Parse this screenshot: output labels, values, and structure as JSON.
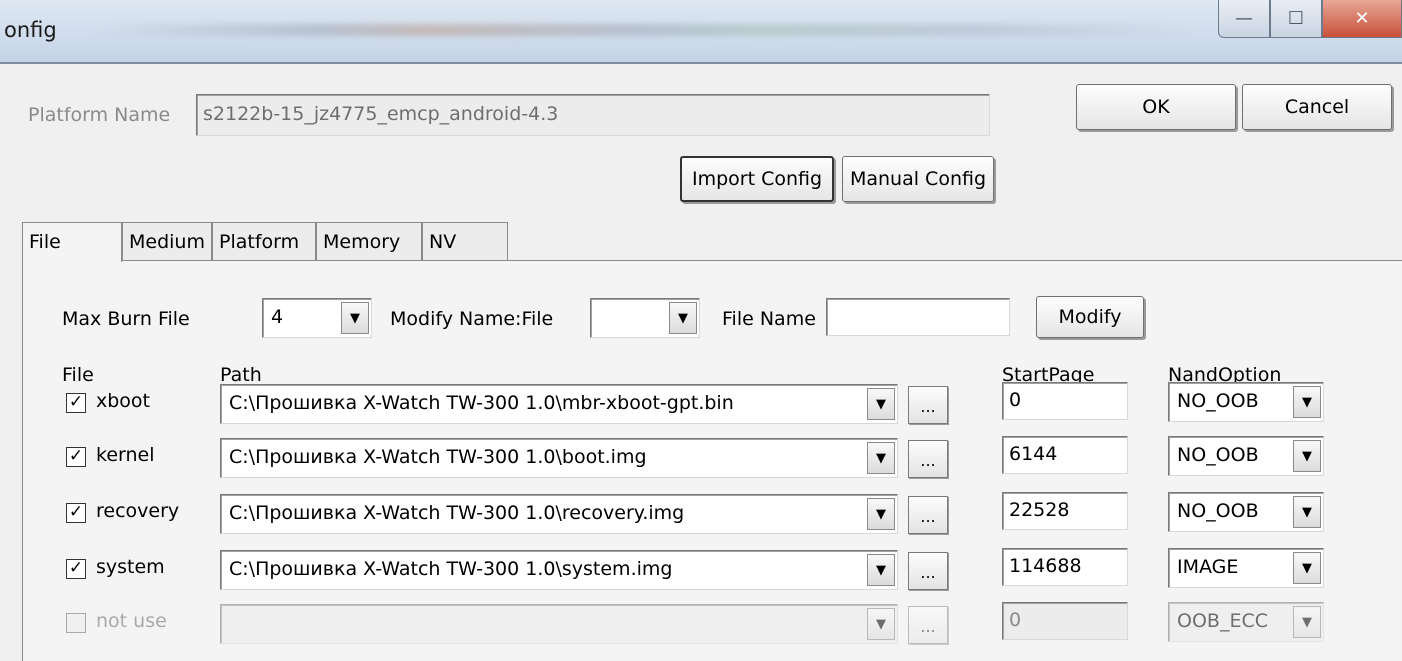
{
  "window": {
    "title": "onfig",
    "minimize_glyph": "—",
    "maximize_glyph": "☐",
    "close_glyph": "✕"
  },
  "header": {
    "platform_label": "Platform Name",
    "platform_value": "s2122b-15_jz4775_emcp_android-4.3",
    "ok": "OK",
    "cancel": "Cancel",
    "import_config": "Import Config",
    "manual_config": "Manual Config"
  },
  "tabs": [
    "File",
    "Medium",
    "Platform",
    "Memory",
    "NV"
  ],
  "file_tab": {
    "max_burn_label": "Max Burn File",
    "max_burn_value": "4",
    "modify_name_label": "Modify Name:File",
    "modify_name_value": "",
    "file_name_label": "File Name",
    "file_name_value": "",
    "modify_button": "Modify",
    "columns": {
      "file": "File",
      "path": "Path",
      "start_page": "StartPage",
      "nand_option": "NandOption"
    },
    "ellipsis": "...",
    "dropdown_icon": "chevron-down-icon",
    "rows": [
      {
        "checked": true,
        "name": "xboot",
        "path": "C:\\Прошивка X-Watch TW-300 1.0\\mbr-xboot-gpt.bin",
        "start_page": "0",
        "nand_option": "NO_OOB",
        "enabled": true
      },
      {
        "checked": true,
        "name": "kernel",
        "path": "C:\\Прошивка X-Watch TW-300 1.0\\boot.img",
        "start_page": "6144",
        "nand_option": "NO_OOB",
        "enabled": true
      },
      {
        "checked": true,
        "name": "recovery",
        "path": "C:\\Прошивка X-Watch TW-300 1.0\\recovery.img",
        "start_page": "22528",
        "nand_option": "NO_OOB",
        "enabled": true
      },
      {
        "checked": true,
        "name": "system",
        "path": "C:\\Прошивка X-Watch TW-300 1.0\\system.img",
        "start_page": "114688",
        "nand_option": "IMAGE",
        "enabled": true
      },
      {
        "checked": false,
        "name": "not use",
        "path": "",
        "start_page": "0",
        "nand_option": "OOB_ECC",
        "enabled": false
      }
    ]
  }
}
